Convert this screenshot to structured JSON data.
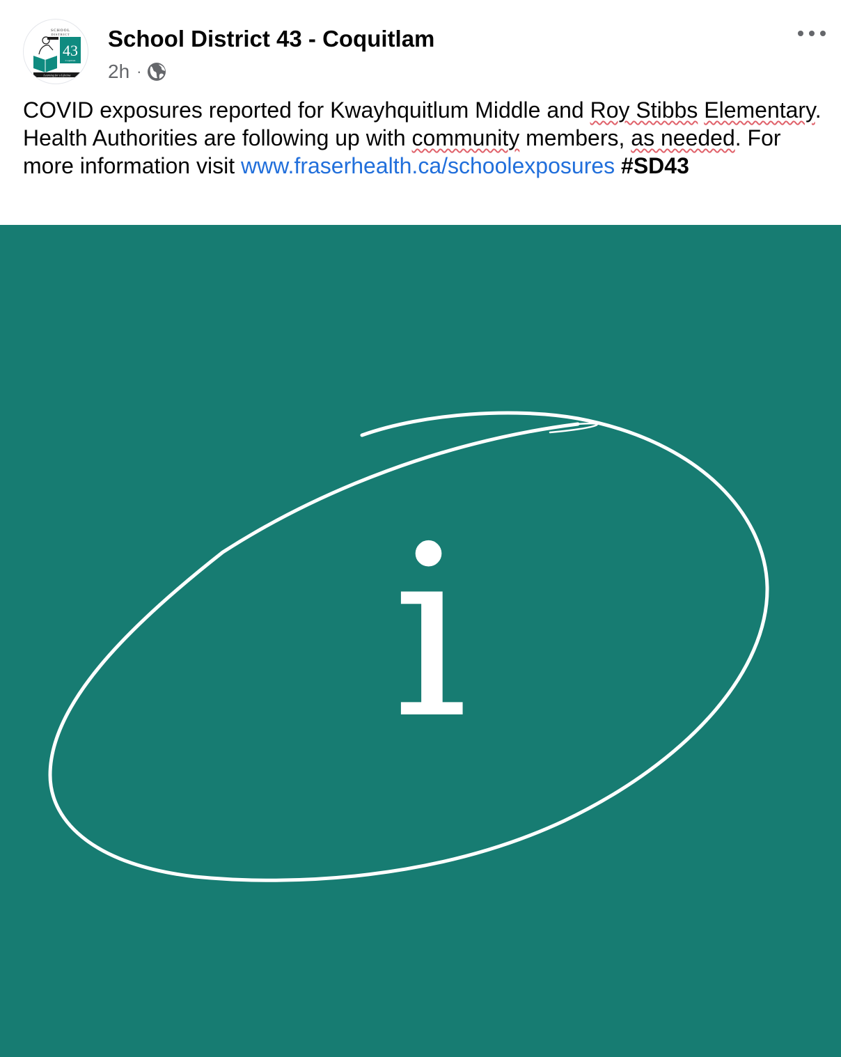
{
  "post": {
    "author": "School District 43 - Coquitlam",
    "time": "2h",
    "separator": "·",
    "privacy_icon": "globe-icon",
    "more_icon": "ellipsis-icon",
    "avatar": {
      "logo_line1": "SCHOOL",
      "logo_line2": "DISTRICT",
      "logo_number": "43",
      "logo_sub": "Coquitlam",
      "logo_tagline": "Learning for a Lifetime",
      "logo_colors": {
        "accent": "#0f8b80",
        "dark": "#1b1b1b"
      }
    },
    "caption": {
      "part1": "COVID exposures reported for Kwayhquitlum Middle and ",
      "spell1": "Roy Stibbs",
      "part2": " ",
      "spell2": "Elementary",
      "part3": ". Health Authorities are following up with ",
      "spell3": "community",
      "part4": " members, ",
      "spell4": "as needed",
      "part5": ". For more information visit ",
      "link": "www.fraserhealth.ca/schoolexposures",
      "part6": " ",
      "hashtag": "#SD43"
    },
    "image": {
      "background": "#177c72",
      "symbol": "i",
      "symbol_color": "#ffffff"
    }
  }
}
